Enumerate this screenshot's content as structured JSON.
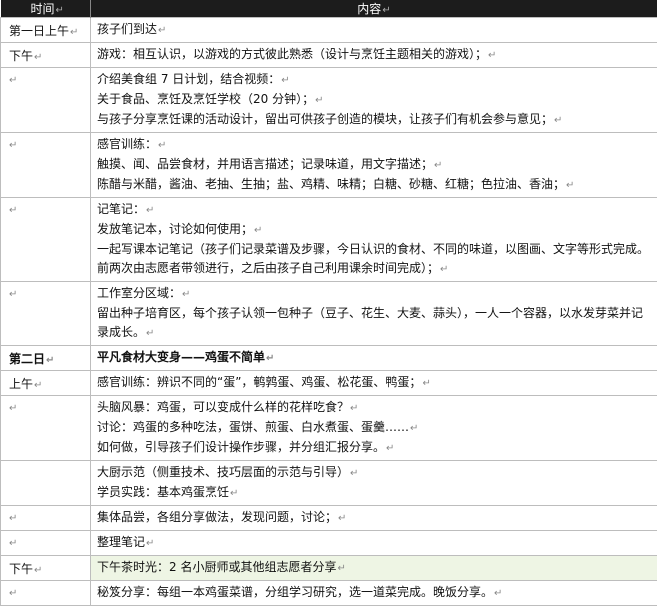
{
  "header": {
    "time": "时间",
    "content": "内容"
  },
  "rows": [
    {
      "time": "第一日上午",
      "lines": [
        "孩子们到达"
      ]
    },
    {
      "time": "下午",
      "lines": [
        "游戏：相互认识，以游戏的方式彼此熟悉（设计与烹饪主题相关的游戏）；"
      ]
    },
    {
      "time": "",
      "lines": [
        "介绍美食组 7 日计划，结合视频：",
        "关于食品、烹饪及烹饪学校（20 分钟）；",
        "与孩子分享烹饪课的活动设计，留出可供孩子创造的模块，让孩子们有机会参与意见；"
      ]
    },
    {
      "time": "",
      "lines": [
        "感官训练：",
        "触摸、闻、品尝食材，并用语言描述；记录味道，用文字描述；",
        "陈醋与米醋，酱油、老抽、生抽；盐、鸡精、味精；白糖、砂糖、红糖；色拉油、香油；"
      ]
    },
    {
      "time": "",
      "lines": [
        "记笔记：",
        "发放笔记本，讨论如何使用；",
        "一起写课本记笔记（孩子们记录菜谱及步骤，今日认识的食材、不同的味道，以图画、文字等形式完成。",
        "前两次由志愿者带领进行，之后由孩子自己利用课余时间完成）；"
      ]
    },
    {
      "time": "",
      "lines": [
        "工作室分区域：",
        "留出种子培育区，每个孩子认领一包种子（豆子、花生、大麦、蒜头），一人一个容器，以水发芽菜并记",
        "录成长。"
      ]
    },
    {
      "time": "第二日",
      "lines": [
        "平凡食材大变身——鸡蛋不简单"
      ]
    },
    {
      "time": "上午",
      "lines": [
        "感官训练：辨识不同的“蛋”，鹌鹑蛋、鸡蛋、松花蛋、鸭蛋；"
      ]
    },
    {
      "time": "",
      "lines": [
        "头脑风暴：鸡蛋，可以变成什么样的花样吃食？",
        "讨论：鸡蛋的多种吃法，蛋饼、煎蛋、白水煮蛋、蛋羹……",
        "如何做，引导孩子们设计操作步骤，并分组汇报分享。"
      ]
    },
    {
      "time": "",
      "lines": [
        "大厨示范（侧重技术、技巧层面的示范与引导）",
        "学员实践：基本鸡蛋烹饪"
      ]
    },
    {
      "time": "",
      "lines": [
        "集体品尝，各组分享做法，发现问题，讨论；"
      ]
    },
    {
      "time": "",
      "lines": [
        "整理笔记"
      ]
    },
    {
      "time": "下午",
      "lines": [
        "下午茶时光：2 名小厨师或其他组志愿者分享"
      ]
    },
    {
      "time": "",
      "lines": [
        "秘笈分享：每组一本鸡蛋菜谱，分组学习研究，选一道菜完成。晚饭分享。"
      ]
    }
  ],
  "para_mark": "↵"
}
